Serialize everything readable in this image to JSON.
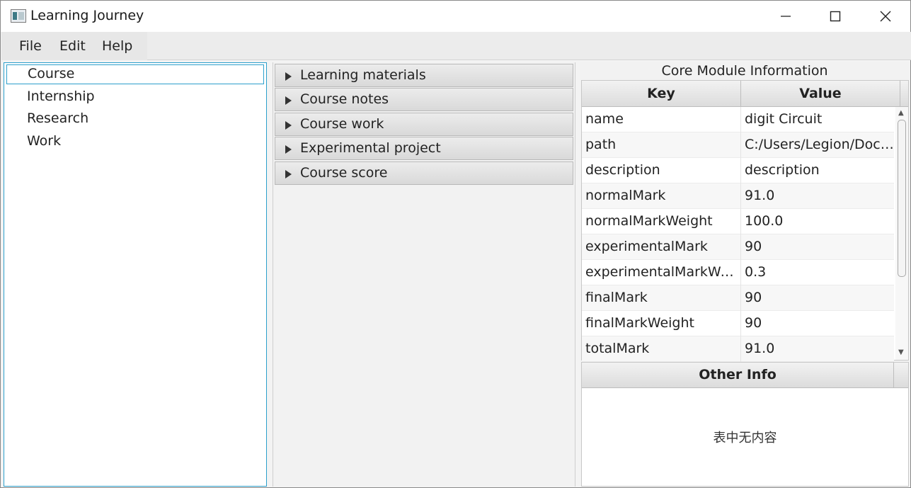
{
  "window": {
    "title": "Learning Journey"
  },
  "menu": {
    "file": "File",
    "edit": "Edit",
    "help": "Help"
  },
  "tree": {
    "items": [
      "Course",
      "Internship",
      "Research",
      "Work"
    ],
    "selected": "Course"
  },
  "accordion": {
    "items": [
      "Learning materials",
      "Course notes",
      "Course work",
      "Experimental project",
      "Course score"
    ]
  },
  "core_module": {
    "title": "Core Module Information",
    "columns": {
      "key": "Key",
      "value": "Value"
    },
    "rows": [
      {
        "key": "name",
        "value": "digit Circuit"
      },
      {
        "key": "path",
        "value": "C:/Users/Legion/Docu..."
      },
      {
        "key": "description",
        "value": "description"
      },
      {
        "key": "normalMark",
        "value": "91.0"
      },
      {
        "key": "normalMarkWeight",
        "value": "100.0"
      },
      {
        "key": "experimentalMark",
        "value": "90"
      },
      {
        "key": "experimentalMarkWei...",
        "value": "0.3"
      },
      {
        "key": "finalMark",
        "value": "90"
      },
      {
        "key": "finalMarkWeight",
        "value": "90"
      },
      {
        "key": "totalMark",
        "value": "91.0"
      }
    ]
  },
  "other_info": {
    "header": "Other Info",
    "empty_message": "表中无内容"
  },
  "colors": {
    "selection_border": "#2c9fcb",
    "background": "#f3f3f3"
  },
  "icons": [
    "app-icon",
    "minimize-icon",
    "maximize-icon",
    "close-icon",
    "expand-arrow-icon",
    "scroll-up-icon",
    "scroll-down-icon"
  ]
}
